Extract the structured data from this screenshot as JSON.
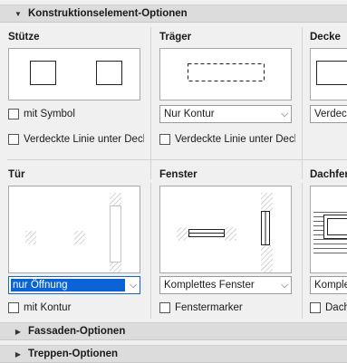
{
  "sections": {
    "konstruktion": "Konstruktionselement-Optionen",
    "fassaden": "Fassaden-Optionen",
    "treppen": "Treppen-Optionen"
  },
  "stuetze": {
    "title": "Stütze",
    "checkbox1": "mit Symbol",
    "checkbox2": "Verdeckte Linie unter Decke"
  },
  "traeger": {
    "title": "Träger",
    "select": "Nur Kontur",
    "checkbox": "Verdeckte Linie unter Decke"
  },
  "decke": {
    "title": "Decke",
    "select": "Verdeckt"
  },
  "tuer": {
    "title": "Tür",
    "select": "nur Öffnung",
    "checkbox": "mit Kontur"
  },
  "fenster": {
    "title": "Fenster",
    "select": "Komplettes Fenster",
    "checkbox": "Fenstermarker"
  },
  "dachfenster": {
    "title": "Dachfenster",
    "select": "Komple",
    "checkbox": "Dachfe"
  },
  "colors": {
    "header_bg": "#dcdcdc",
    "selection": "#0a64d6",
    "panel_bg": "#f0f0f0"
  }
}
